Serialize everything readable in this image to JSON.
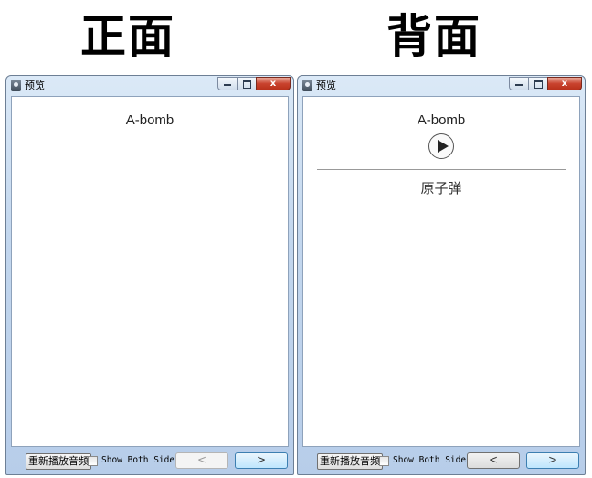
{
  "headings": {
    "front": "正面",
    "back": "背面"
  },
  "window": {
    "title": "预览",
    "buttons": {
      "minimize": "–",
      "maximize": "□",
      "close": "x"
    }
  },
  "front_card": {
    "term": "A-bomb"
  },
  "back_card": {
    "term": "A-bomb",
    "answer": "原子弹",
    "play_icon": "play-circle-icon"
  },
  "bottombar": {
    "replay_label": "重新播放音频",
    "show_both_label": "Show Both Sides",
    "show_both_checked": false,
    "prev_label": "<",
    "next_label": ">"
  }
}
